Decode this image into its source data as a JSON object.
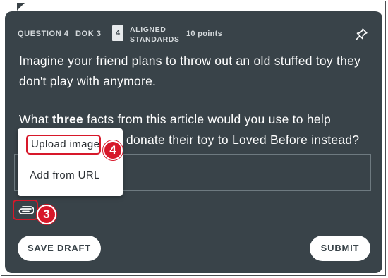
{
  "header": {
    "question_label": "QUESTION 4",
    "dok_label": "DOK 3",
    "standards_count": "4",
    "standards_line1": "ALIGNED",
    "standards_line2": "STANDARDS",
    "points_label": "10 points"
  },
  "question": {
    "paragraph1": "Imagine your friend plans to throw out an old stuffed toy they don't play with anymore.",
    "paragraph2_prefix": "What ",
    "paragraph2_bold": "three",
    "paragraph2_line1_rest": " facts from this article would you use to help",
    "paragraph2_line2_tail": "donate their toy to Loved Before instead?"
  },
  "attach_menu": {
    "upload_label": "Upload image",
    "url_label": "Add from URL"
  },
  "callouts": {
    "upload_step": "4",
    "attach_step": "3"
  },
  "footer": {
    "save_label": "SAVE DRAFT",
    "submit_label": "SUBMIT"
  },
  "icons": {
    "pin": "pin-icon",
    "paperclip": "paperclip-icon"
  },
  "colors": {
    "card_bg": "#394349",
    "highlight": "#d7182a"
  }
}
